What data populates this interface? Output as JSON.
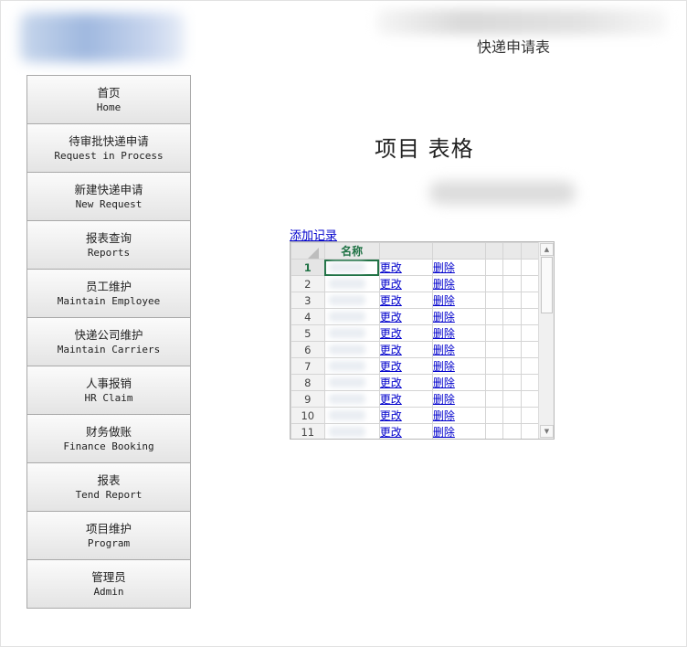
{
  "header": {
    "title": "快递申请表"
  },
  "nav": [
    {
      "cn": "首页",
      "en": "Home"
    },
    {
      "cn": "待审批快递申请",
      "en": "Request in Process"
    },
    {
      "cn": "新建快递申请",
      "en": "New Request"
    },
    {
      "cn": "报表查询",
      "en": "Reports"
    },
    {
      "cn": "员工维护",
      "en": "Maintain Employee"
    },
    {
      "cn": "快递公司维护",
      "en": "Maintain Carriers"
    },
    {
      "cn": "人事报销",
      "en": "HR Claim"
    },
    {
      "cn": "财务做账",
      "en": "Finance Booking"
    },
    {
      "cn": "报表",
      "en": "Tend Report"
    },
    {
      "cn": "项目维护",
      "en": "Program"
    },
    {
      "cn": "管理员",
      "en": "Admin"
    }
  ],
  "main": {
    "title": "项目  表格",
    "add_link": "添加记录",
    "grid": {
      "columns": [
        "名称",
        "",
        "",
        "",
        "",
        ""
      ],
      "rows": [
        "1",
        "2",
        "3",
        "4",
        "5",
        "6",
        "7",
        "8",
        "9",
        "10",
        "11"
      ],
      "edit_label": "更改",
      "delete_label": "删除"
    }
  },
  "colors": {
    "link": "#0000cc",
    "grid_accent": "#217346"
  }
}
